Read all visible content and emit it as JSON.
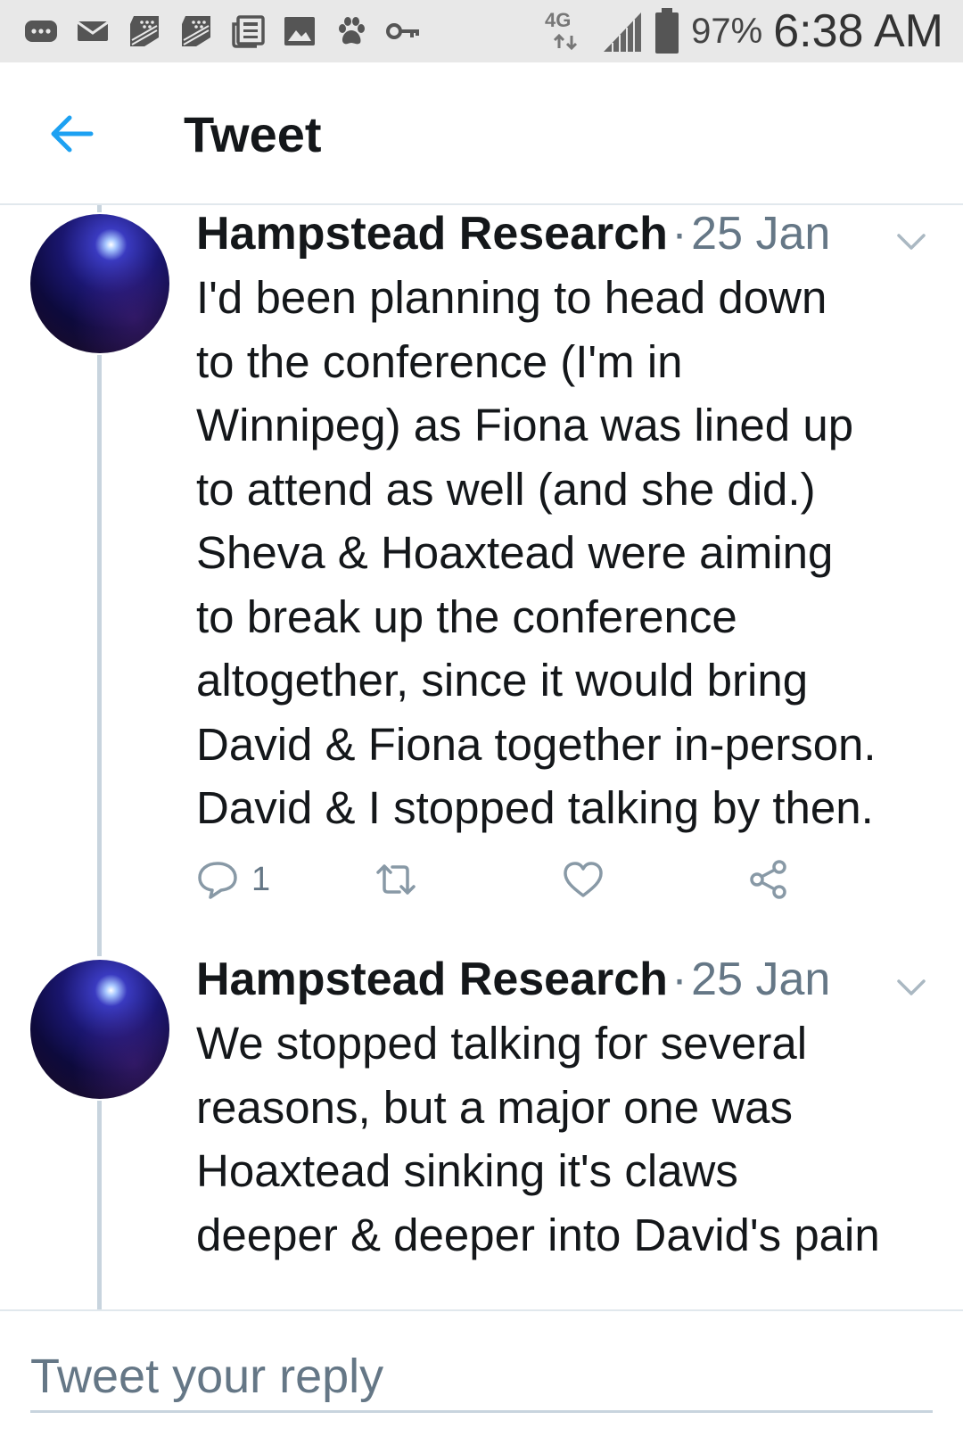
{
  "status_bar": {
    "battery_percent": "97%",
    "time": "6:38 AM",
    "network": "4G",
    "icons": [
      "more-icon",
      "mail-icon",
      "blackberry-icon",
      "blackberry-icon",
      "news-icon",
      "image-icon",
      "paw-icon",
      "key-icon",
      "network-4g-icon",
      "signal-icon",
      "battery-icon"
    ]
  },
  "header": {
    "title": "Tweet",
    "back_icon": "back-arrow-icon",
    "accent_color": "#1da1f2"
  },
  "tweets": [
    {
      "author": "Hampstead Research",
      "separator": "·",
      "date": "25 Jan",
      "lines": [
        "I'd been planning to head down",
        "to the conference (I'm in",
        "Winnipeg) as Fiona was lined up",
        "to attend as well (and she did.)",
        "Sheva & Hoaxtead were aiming",
        "to break up the conference",
        "altogether, since it would bring",
        "David & Fiona together in-person.",
        "David & I stopped talking by then."
      ],
      "reply_count": "1"
    },
    {
      "author": "Hampstead Research",
      "separator": "·",
      "date": "25 Jan",
      "lines": [
        "We stopped talking for several",
        "reasons, but a major one was",
        "Hoaxtead sinking it's claws",
        "deeper & deeper into David's pain"
      ]
    }
  ],
  "reply": {
    "placeholder": "Tweet your reply"
  }
}
